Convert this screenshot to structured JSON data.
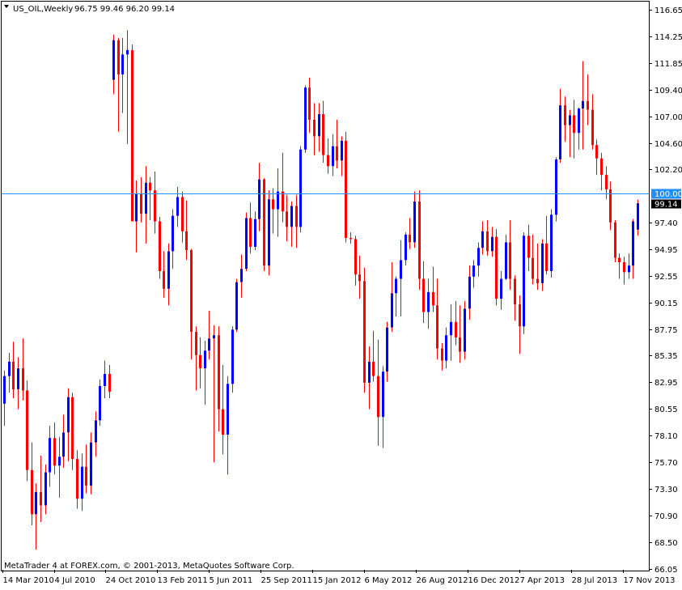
{
  "header": {
    "symbol": "US_OIL,Weekly",
    "ohlc": "96.75 99.46 96.20 99.14"
  },
  "footer": {
    "credit": "MetaTrader 4 at FOREX.com, © 2001-2013, MetaQuotes Software Corp."
  },
  "colors": {
    "background": "#ffffff",
    "bull": "#0000ff",
    "bear": "#ff0000",
    "wick": "#ff0000",
    "hline": "#1e90ff",
    "axis": "#000000"
  },
  "chart_data": {
    "type": "candlestick",
    "title": "US_OIL,Weekly",
    "y_ticks": [
      "116.65",
      "114.25",
      "111.85",
      "109.40",
      "107.00",
      "104.60",
      "102.20",
      "97.40",
      "94.95",
      "92.55",
      "90.15",
      "87.75",
      "85.35",
      "82.95",
      "80.55",
      "78.10",
      "75.70",
      "73.30",
      "70.90",
      "68.50",
      "66.05"
    ],
    "ylim": [
      66.05,
      116.65
    ],
    "x_ticks": [
      "14 Mar 2010",
      "4 Jul 2010",
      "24 Oct 2010",
      "13 Feb 2011",
      "5 Jun 2011",
      "25 Sep 2011",
      "15 Jan 2012",
      "6 May 2012",
      "26 Aug 2012",
      "16 Dec 2012",
      "7 Apr 2013",
      "28 Jul 2013",
      "17 Nov 2013"
    ],
    "horizontal_line": {
      "value": 100.0,
      "label": "100.00"
    },
    "last_price": {
      "value": 99.14,
      "label": "99.14"
    },
    "grid": false,
    "candles": [
      {
        "o": 81.0,
        "h": 84.0,
        "l": 79.0,
        "c": 83.5
      },
      {
        "o": 83.5,
        "h": 85.6,
        "l": 82.0,
        "c": 84.8
      },
      {
        "o": 84.8,
        "h": 86.6,
        "l": 81.5,
        "c": 82.3
      },
      {
        "o": 82.3,
        "h": 85.2,
        "l": 80.5,
        "c": 84.2
      },
      {
        "o": 84.2,
        "h": 86.9,
        "l": 81.3,
        "c": 82.2
      },
      {
        "o": 82.2,
        "h": 83.1,
        "l": 74.0,
        "c": 75.0
      },
      {
        "o": 75.0,
        "h": 77.5,
        "l": 70.0,
        "c": 71.0
      },
      {
        "o": 71.0,
        "h": 73.8,
        "l": 67.8,
        "c": 73.0
      },
      {
        "o": 73.0,
        "h": 76.3,
        "l": 70.3,
        "c": 71.8
      },
      {
        "o": 71.8,
        "h": 75.5,
        "l": 71.0,
        "c": 74.8
      },
      {
        "o": 74.8,
        "h": 79.0,
        "l": 73.5,
        "c": 77.9
      },
      {
        "o": 77.9,
        "h": 79.3,
        "l": 74.6,
        "c": 75.4
      },
      {
        "o": 75.4,
        "h": 78.0,
        "l": 72.5,
        "c": 76.2
      },
      {
        "o": 76.2,
        "h": 80.0,
        "l": 75.2,
        "c": 78.4
      },
      {
        "o": 78.4,
        "h": 82.4,
        "l": 75.8,
        "c": 81.6
      },
      {
        "o": 81.6,
        "h": 82.0,
        "l": 75.0,
        "c": 76.0
      },
      {
        "o": 76.0,
        "h": 76.8,
        "l": 71.5,
        "c": 72.4
      },
      {
        "o": 72.4,
        "h": 76.5,
        "l": 71.3,
        "c": 75.3
      },
      {
        "o": 75.3,
        "h": 77.3,
        "l": 72.9,
        "c": 73.6
      },
      {
        "o": 73.6,
        "h": 78.4,
        "l": 72.8,
        "c": 77.5
      },
      {
        "o": 77.5,
        "h": 80.3,
        "l": 76.2,
        "c": 79.5
      },
      {
        "o": 79.5,
        "h": 83.2,
        "l": 79.0,
        "c": 82.6
      },
      {
        "o": 82.6,
        "h": 84.9,
        "l": 81.5,
        "c": 83.7
      },
      {
        "o": 83.7,
        "h": 84.5,
        "l": 81.5,
        "c": 82.1
      },
      {
        "o": 110.3,
        "h": 114.4,
        "l": 109.0,
        "c": 113.9
      },
      {
        "o": 113.9,
        "h": 114.1,
        "l": 105.6,
        "c": 110.8
      },
      {
        "o": 110.8,
        "h": 114.1,
        "l": 107.3,
        "c": 112.6
      },
      {
        "o": 112.6,
        "h": 114.8,
        "l": 104.5,
        "c": 113.0
      },
      {
        "o": 113.0,
        "h": 113.5,
        "l": 103.0,
        "c": 97.5
      },
      {
        "o": 97.5,
        "h": 101.2,
        "l": 94.7,
        "c": 100.0
      },
      {
        "o": 100.0,
        "h": 101.5,
        "l": 97.4,
        "c": 98.2
      },
      {
        "o": 98.2,
        "h": 102.5,
        "l": 95.5,
        "c": 101.0
      },
      {
        "o": 101.0,
        "h": 101.5,
        "l": 97.6,
        "c": 100.3
      },
      {
        "o": 100.3,
        "h": 102.0,
        "l": 96.4,
        "c": 97.5
      },
      {
        "o": 97.5,
        "h": 97.9,
        "l": 92.3,
        "c": 93.0
      },
      {
        "o": 93.0,
        "h": 94.8,
        "l": 90.6,
        "c": 91.4
      },
      {
        "o": 91.4,
        "h": 95.5,
        "l": 89.9,
        "c": 94.8
      },
      {
        "o": 94.8,
        "h": 98.6,
        "l": 93.2,
        "c": 98.0
      },
      {
        "o": 98.0,
        "h": 100.6,
        "l": 97.0,
        "c": 99.7
      },
      {
        "o": 99.7,
        "h": 100.2,
        "l": 95.6,
        "c": 96.6
      },
      {
        "o": 96.6,
        "h": 99.4,
        "l": 94.0,
        "c": 94.9
      },
      {
        "o": 94.9,
        "h": 95.0,
        "l": 85.0,
        "c": 87.5
      },
      {
        "o": 87.5,
        "h": 88.0,
        "l": 82.2,
        "c": 85.4
      },
      {
        "o": 85.4,
        "h": 87.0,
        "l": 82.4,
        "c": 84.2
      },
      {
        "o": 84.2,
        "h": 86.7,
        "l": 80.9,
        "c": 85.8
      },
      {
        "o": 85.8,
        "h": 89.4,
        "l": 85.0,
        "c": 86.9
      },
      {
        "o": 86.9,
        "h": 88.1,
        "l": 75.7,
        "c": 87.2
      },
      {
        "o": 87.2,
        "h": 88.0,
        "l": 78.5,
        "c": 80.5
      },
      {
        "o": 80.5,
        "h": 84.5,
        "l": 76.4,
        "c": 78.2
      },
      {
        "o": 78.2,
        "h": 83.5,
        "l": 74.6,
        "c": 82.8
      },
      {
        "o": 82.8,
        "h": 88.0,
        "l": 82.0,
        "c": 87.7
      },
      {
        "o": 87.7,
        "h": 92.3,
        "l": 87.5,
        "c": 92.0
      },
      {
        "o": 92.0,
        "h": 94.5,
        "l": 90.6,
        "c": 93.2
      },
      {
        "o": 93.2,
        "h": 98.3,
        "l": 93.0,
        "c": 97.8
      },
      {
        "o": 97.8,
        "h": 99.2,
        "l": 94.6,
        "c": 95.2
      },
      {
        "o": 95.2,
        "h": 98.4,
        "l": 94.9,
        "c": 97.7
      },
      {
        "o": 97.7,
        "h": 102.8,
        "l": 96.6,
        "c": 101.3
      },
      {
        "o": 101.3,
        "h": 101.4,
        "l": 93.0,
        "c": 93.5
      },
      {
        "o": 93.5,
        "h": 100.3,
        "l": 92.6,
        "c": 99.5
      },
      {
        "o": 99.5,
        "h": 100.5,
        "l": 96.4,
        "c": 98.6
      },
      {
        "o": 98.6,
        "h": 102.3,
        "l": 96.1,
        "c": 100.2
      },
      {
        "o": 100.2,
        "h": 103.7,
        "l": 97.4,
        "c": 98.4
      },
      {
        "o": 98.4,
        "h": 99.9,
        "l": 95.7,
        "c": 97.0
      },
      {
        "o": 97.0,
        "h": 99.3,
        "l": 95.2,
        "c": 98.9
      },
      {
        "o": 98.9,
        "h": 99.9,
        "l": 95.1,
        "c": 97.0
      },
      {
        "o": 97.0,
        "h": 104.3,
        "l": 96.5,
        "c": 104.0
      },
      {
        "o": 104.0,
        "h": 109.8,
        "l": 103.7,
        "c": 109.6
      },
      {
        "o": 109.6,
        "h": 110.5,
        "l": 105.5,
        "c": 106.7
      },
      {
        "o": 106.7,
        "h": 108.2,
        "l": 103.5,
        "c": 105.2
      },
      {
        "o": 105.2,
        "h": 108.2,
        "l": 103.8,
        "c": 107.2
      },
      {
        "o": 107.2,
        "h": 108.4,
        "l": 102.8,
        "c": 103.5
      },
      {
        "o": 103.5,
        "h": 105.0,
        "l": 101.8,
        "c": 102.5
      },
      {
        "o": 102.5,
        "h": 105.4,
        "l": 101.6,
        "c": 104.3
      },
      {
        "o": 104.3,
        "h": 106.7,
        "l": 102.3,
        "c": 103.0
      },
      {
        "o": 103.0,
        "h": 105.2,
        "l": 101.6,
        "c": 104.8
      },
      {
        "o": 104.8,
        "h": 105.6,
        "l": 95.6,
        "c": 96.0
      },
      {
        "o": 96.0,
        "h": 96.5,
        "l": 95.5,
        "c": 95.9
      },
      {
        "o": 95.9,
        "h": 96.2,
        "l": 91.7,
        "c": 92.7
      },
      {
        "o": 92.7,
        "h": 94.4,
        "l": 90.5,
        "c": 92.1
      },
      {
        "o": 92.1,
        "h": 93.3,
        "l": 82.0,
        "c": 82.9
      },
      {
        "o": 82.9,
        "h": 86.2,
        "l": 80.5,
        "c": 84.8
      },
      {
        "o": 84.8,
        "h": 87.6,
        "l": 83.0,
        "c": 83.5
      },
      {
        "o": 83.5,
        "h": 86.8,
        "l": 77.2,
        "c": 79.8
      },
      {
        "o": 79.8,
        "h": 84.4,
        "l": 77.0,
        "c": 83.9
      },
      {
        "o": 83.9,
        "h": 88.4,
        "l": 83.0,
        "c": 87.9
      },
      {
        "o": 87.9,
        "h": 93.8,
        "l": 87.5,
        "c": 91.0
      },
      {
        "o": 91.0,
        "h": 92.5,
        "l": 88.9,
        "c": 92.3
      },
      {
        "o": 92.3,
        "h": 95.8,
        "l": 88.9,
        "c": 94.0
      },
      {
        "o": 94.0,
        "h": 96.5,
        "l": 93.5,
        "c": 96.3
      },
      {
        "o": 96.3,
        "h": 97.8,
        "l": 95.0,
        "c": 95.6
      },
      {
        "o": 95.6,
        "h": 100.2,
        "l": 95.1,
        "c": 99.3
      },
      {
        "o": 99.3,
        "h": 100.3,
        "l": 91.3,
        "c": 92.3
      },
      {
        "o": 92.3,
        "h": 93.9,
        "l": 88.3,
        "c": 89.3
      },
      {
        "o": 89.3,
        "h": 92.3,
        "l": 87.8,
        "c": 91.1
      },
      {
        "o": 91.1,
        "h": 93.4,
        "l": 89.3,
        "c": 89.9
      },
      {
        "o": 89.9,
        "h": 92.3,
        "l": 85.0,
        "c": 86.0
      },
      {
        "o": 86.0,
        "h": 86.5,
        "l": 84.0,
        "c": 84.9
      },
      {
        "o": 84.9,
        "h": 87.9,
        "l": 84.2,
        "c": 87.2
      },
      {
        "o": 87.2,
        "h": 90.0,
        "l": 84.9,
        "c": 88.4
      },
      {
        "o": 88.4,
        "h": 90.3,
        "l": 86.3,
        "c": 87.0
      },
      {
        "o": 87.0,
        "h": 89.9,
        "l": 84.7,
        "c": 85.7
      },
      {
        "o": 85.7,
        "h": 90.3,
        "l": 85.0,
        "c": 89.6
      },
      {
        "o": 89.6,
        "h": 93.5,
        "l": 88.6,
        "c": 92.5
      },
      {
        "o": 92.5,
        "h": 94.0,
        "l": 91.5,
        "c": 93.5
      },
      {
        "o": 93.5,
        "h": 95.6,
        "l": 92.5,
        "c": 95.1
      },
      {
        "o": 95.1,
        "h": 97.5,
        "l": 94.5,
        "c": 96.6
      },
      {
        "o": 96.6,
        "h": 97.6,
        "l": 94.4,
        "c": 94.8
      },
      {
        "o": 94.8,
        "h": 97.0,
        "l": 94.3,
        "c": 96.1
      },
      {
        "o": 96.1,
        "h": 96.8,
        "l": 89.9,
        "c": 90.5
      },
      {
        "o": 90.5,
        "h": 93.0,
        "l": 89.5,
        "c": 92.3
      },
      {
        "o": 92.3,
        "h": 96.3,
        "l": 92.2,
        "c": 95.6
      },
      {
        "o": 95.6,
        "h": 97.6,
        "l": 91.3,
        "c": 92.3
      },
      {
        "o": 92.3,
        "h": 92.6,
        "l": 88.5,
        "c": 90.0
      },
      {
        "o": 90.0,
        "h": 90.8,
        "l": 85.5,
        "c": 88.0
      },
      {
        "o": 88.0,
        "h": 96.5,
        "l": 87.3,
        "c": 96.2
      },
      {
        "o": 96.2,
        "h": 97.2,
        "l": 93.0,
        "c": 94.2
      },
      {
        "o": 94.2,
        "h": 96.3,
        "l": 91.8,
        "c": 92.3
      },
      {
        "o": 92.3,
        "h": 95.5,
        "l": 91.3,
        "c": 91.9
      },
      {
        "o": 91.9,
        "h": 95.9,
        "l": 91.2,
        "c": 95.5
      },
      {
        "o": 95.5,
        "h": 98.0,
        "l": 92.7,
        "c": 93.0
      },
      {
        "o": 93.0,
        "h": 98.6,
        "l": 92.4,
        "c": 98.1
      },
      {
        "o": 98.1,
        "h": 103.3,
        "l": 97.5,
        "c": 103.1
      },
      {
        "o": 103.1,
        "h": 109.5,
        "l": 102.8,
        "c": 108.0
      },
      {
        "o": 108.0,
        "h": 108.8,
        "l": 104.7,
        "c": 106.2
      },
      {
        "o": 106.2,
        "h": 107.6,
        "l": 103.3,
        "c": 107.1
      },
      {
        "o": 107.1,
        "h": 108.5,
        "l": 103.2,
        "c": 105.5
      },
      {
        "o": 105.5,
        "h": 107.8,
        "l": 104.0,
        "c": 107.7
      },
      {
        "o": 107.7,
        "h": 112.0,
        "l": 104.0,
        "c": 108.4
      },
      {
        "o": 108.4,
        "h": 110.8,
        "l": 106.2,
        "c": 107.6
      },
      {
        "o": 107.6,
        "h": 109.0,
        "l": 104.0,
        "c": 104.4
      },
      {
        "o": 104.4,
        "h": 104.9,
        "l": 101.7,
        "c": 103.2
      },
      {
        "o": 103.2,
        "h": 103.7,
        "l": 100.3,
        "c": 101.7
      },
      {
        "o": 101.7,
        "h": 102.5,
        "l": 99.5,
        "c": 100.4
      },
      {
        "o": 100.4,
        "h": 101.1,
        "l": 96.7,
        "c": 97.4
      },
      {
        "o": 97.4,
        "h": 97.6,
        "l": 93.8,
        "c": 94.2
      },
      {
        "o": 94.2,
        "h": 94.6,
        "l": 92.3,
        "c": 93.8
      },
      {
        "o": 93.8,
        "h": 94.3,
        "l": 91.8,
        "c": 92.9
      },
      {
        "o": 92.9,
        "h": 94.6,
        "l": 92.3,
        "c": 93.5
      },
      {
        "o": 93.5,
        "h": 97.7,
        "l": 92.3,
        "c": 97.5
      },
      {
        "o": 96.75,
        "h": 99.46,
        "l": 96.2,
        "c": 99.14
      }
    ]
  }
}
